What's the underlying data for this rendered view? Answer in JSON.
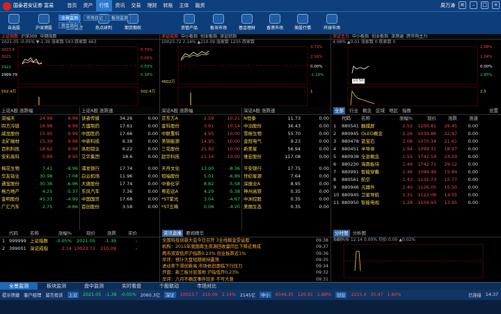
{
  "app": {
    "title": "国泰君安证券 富易",
    "user": "周万涛"
  },
  "menu": [
    "首页",
    "资产",
    "行情",
    "资讯",
    "交易",
    "理财",
    "转账",
    "主体",
    "融资"
  ],
  "tools": [
    "自选股",
    "沪深港股",
    "全景监控",
    "热点研判",
    "期货期权",
    "资管产品",
    "板块市场",
    "基金理财",
    "香港市场",
    "美股行情",
    "环球市场"
  ],
  "subtabs": [
    "全景监测",
    "市场日记",
    "板块监测",
    "资金流向"
  ],
  "panels": [
    {
      "tabs": [
        "上证指数",
        "沪深300",
        "中期指数"
      ],
      "info": "2021.05 -0.05% ▼-1.39 涨家数 593 跌家数 663",
      "yl": [
        "3023.6",
        "3021",
        "2922",
        "2999.79"
      ],
      "yr": [
        "0.70%",
        "0.05%",
        "0.03%",
        "0.30%"
      ],
      "vol": [
        "502.4万",
        "502.4万"
      ]
    },
    {
      "tabs": [
        "深证成指",
        "中小板指",
        "创业板指",
        "深证综指"
      ],
      "info": "10023.72 2.14% ▲210.09 涨家数 1235 跌家数",
      "yl": [
        "",
        "",
        "",
        ""
      ],
      "yr": [
        "3.73%",
        "2.16%",
        "0.00%",
        "-1.10%"
      ],
      "vol": [
        "4602万",
        "1"
      ]
    },
    {
      "tabs": [
        "深证主力",
        "中小板指",
        "创业板指",
        "深港通",
        "跨市场主力"
      ],
      "info": "4.08% ▲0.01 涨家数 0 跌家数 0",
      "yl": [
        "",
        "",
        "",
        ""
      ],
      "yr": [
        "2.68%",
        "1.04%",
        "0.00%",
        "2.85%"
      ],
      "vol": [
        "10.50",
        "2.5"
      ]
    }
  ],
  "sh_gainers": [
    [
      "润福天",
      "24.99",
      "9.99"
    ],
    [
      "四方冷链",
      "19.99",
      "9.99"
    ],
    [
      "威龙股份",
      "15.95",
      "9.99"
    ],
    [
      "北矿磁材",
      "15.39",
      "9.98"
    ],
    [
      "百利科技",
      "18.62",
      "9.98"
    ],
    [
      "安彩高科",
      "5.89",
      "9.95"
    ]
  ],
  "sh_losers": [
    [
      "梅花生物",
      "7.41",
      "-9.96"
    ],
    [
      "华友钴业",
      "30.98",
      "-7.08"
    ],
    [
      "通宝股份",
      "30.36",
      "-6.96"
    ],
    [
      "格力地产",
      "4.25",
      "-5.37"
    ],
    [
      "金明股份",
      "45.33",
      "-4.99"
    ],
    [
      "广汇汽车",
      "2.75",
      "-4.86"
    ]
  ],
  "sh_speed": [
    [
      "读者传媒",
      "34.26",
      "0.00"
    ],
    [
      "方盛制药",
      "17.61",
      "0.00"
    ],
    [
      "中国医药",
      "17.66",
      "0.00"
    ],
    [
      "中新科技",
      "6.38",
      "0.00"
    ],
    [
      "洛阳钼业",
      "6.22",
      "0.00"
    ],
    [
      "艾华集团",
      "18.6",
      "0.00"
    ]
  ],
  "sh_speed2": [
    [
      "浦发银行",
      "17.74",
      "0.00"
    ],
    [
      "白云机场",
      "11.96",
      "0.00"
    ],
    [
      "大唐股份",
      "17.74",
      "0.00"
    ],
    [
      "东风汽车",
      "7.36",
      "0.00"
    ],
    [
      "中国国贸",
      "17.68",
      "0.00"
    ],
    [
      "首创股份",
      "3.58",
      "0.00"
    ]
  ],
  "sz_gainers": [
    [
      "京东方A",
      "2.59",
      "10.21"
    ],
    [
      "金科股份",
      "3.91",
      "10.14"
    ],
    [
      "中联重科",
      "4.95",
      "10.00"
    ],
    [
      "美锦能源",
      "14.95",
      "10.00"
    ],
    [
      "三花股份",
      "25.92",
      "10.00"
    ],
    [
      "超华科技",
      "11.14",
      "10.00"
    ]
  ],
  "sz_losers": [
    [
      "天舟文化",
      "13.00",
      "-8.36"
    ],
    [
      "冠福股份",
      "5.01",
      "-6.89"
    ],
    [
      "中泰化学",
      "8.82",
      "-5.58"
    ],
    [
      "粤宏远A",
      "4.20",
      "-5.38"
    ],
    [
      "*ST紫光",
      "3.04",
      "-4.67"
    ],
    [
      "*ST五稀",
      "0.06",
      "-4.20"
    ]
  ],
  "sz_speed": [
    [
      "N恒泰",
      "11.73",
      "0.00"
    ],
    [
      "中泊股份",
      "36.43",
      "0.00"
    ],
    [
      "雪榕生物",
      "55.70",
      "0.00"
    ],
    [
      "金冠电气",
      "9.23",
      "0.00"
    ],
    [
      "新美星",
      "56.94",
      "0.00"
    ],
    [
      "维宏股份",
      "117.08",
      "0.00"
    ]
  ],
  "sz_speed2": [
    [
      "平安银行",
      "17.75",
      "0.00"
    ],
    [
      "世纪星源",
      "7.64",
      "0.00"
    ],
    [
      "深振业A",
      "8.95",
      "0.00"
    ],
    [
      "神州高铁",
      "0.35",
      "0.00"
    ],
    [
      "中洲控股",
      "0.35",
      "0.00"
    ],
    [
      "美丽生态",
      "0.35",
      "0.00"
    ]
  ],
  "headers": {
    "sh_a": "上证A股 涨跌幅",
    "sh_speed": "上证A股 涨跌速",
    "sz_a": "深证A股 涨跌幅",
    "sz_speed": "深证A股 涨跌速"
  },
  "rank": {
    "tabs": [
      "全部",
      "行业",
      "概念",
      "区域",
      "地区",
      "指数"
    ],
    "set": "设置",
    "headers": [
      "",
      "代码",
      "名称",
      "涨幅%",
      "现价",
      "涨跌",
      "涨速"
    ],
    "rows": [
      [
        "1",
        "880541",
        "触摸屏",
        "2.52",
        "1200.81",
        "29.45",
        "0.00"
      ],
      [
        "2",
        "880945",
        "OLED概念",
        "2.26",
        "1039.86",
        "22.97",
        "0.00"
      ],
      [
        "3",
        "880478",
        "蓝宝石",
        "2.08",
        "1070.34",
        "21.61",
        "0.00"
      ],
      [
        "4",
        "880451",
        "半导体",
        "1.94",
        "1099.31",
        "18.97",
        "0.00"
      ],
      [
        "5",
        "880938",
        "全息概念",
        "1.55",
        "1742.19",
        "24.29",
        "0.00"
      ],
      [
        "6",
        "880230",
        "海南板块",
        "1.49",
        "1742.71",
        "29.12",
        "0.00"
      ],
      [
        "7",
        "880991",
        "智能穿戴",
        "1.46",
        "1099.49",
        "15.89",
        "0.00"
      ],
      [
        "8",
        "880561",
        "航空",
        "1.43",
        "1135.73",
        "15.77",
        "0.00"
      ],
      [
        "9",
        "880946",
        "元器件",
        "1.40",
        "1126.05",
        "15.50",
        "0.00"
      ],
      [
        "10",
        "880945",
        "卫星导航",
        "1.31",
        "1122.08",
        "14.55",
        "0.00"
      ],
      [
        "11",
        "880950",
        "智能电视",
        "1.28",
        "1104.93",
        "13.95",
        "0.00"
      ]
    ]
  },
  "indices": {
    "headers": [
      "",
      "代码",
      "名称",
      "涨幅%",
      "现价",
      "涨跌",
      "买价"
    ],
    "rows": [
      [
        "1",
        "999999",
        "上证指数",
        "-0.05%",
        "2021.05",
        "-1.39",
        "-"
      ],
      [
        "2",
        "399001",
        "深证成指",
        "2.14",
        "10023.72",
        "210.09",
        "-"
      ]
    ]
  },
  "news": {
    "tabs": [
      "资讯直播",
      "要闻精华"
    ],
    "items": [
      [
        "全国科技创新大会今日召开 3主线掘金受益股",
        "09:38"
      ],
      [
        "机构：2015年我国再生资源回收量同比下降近两成",
        "09:37"
      ],
      [
        "两市双双低开沪指跌0.23% 创业板跌近1%",
        "09:36"
      ],
      [
        "早评：预计大盘短期维持震荡",
        "09:35"
      ],
      [
        "进动率下滑创新高 市场依旧面临下行压力",
        "09:34"
      ],
      [
        "开盘：新三板分层落地 沪指低开0.23%",
        "09:32"
      ],
      [
        "早评：六月不确定事件较多 不可大意",
        "09:31"
      ],
      [
        "国内主要财经媒体要闻摘编（5月30日）",
        "09:30"
      ],
      [
        "早评：多空推持暂时明朗 部分题材或有机会",
        "09:28"
      ],
      [
        "新能股份（002667）：关于公司股票临时停牌的公告",
        "09:28"
      ]
    ]
  },
  "analysis": {
    "tabs": [
      "分时图",
      "分析图"
    ],
    "info": "海翻科技 12.14 0.00% 均价:0.00 ▲0.02%"
  },
  "btabs": [
    "全景监测",
    "板块监测",
    "盘中监测",
    "实时看盘",
    "个股联动",
    "市场对比"
  ],
  "status": {
    "items": [
      "提示快捷",
      "客户经理",
      "留言投诉",
      "上证",
      "2021.05",
      "-1.39",
      "-0.05%",
      "2060.3亿",
      "深证",
      "10023.7",
      "210.09",
      "2.14%",
      "2145亿",
      "中小",
      "6549.35",
      "120.91",
      "1.88%",
      "创业",
      "2215.4",
      "35.47",
      "1.60%"
    ],
    "right": "已连接",
    "time": "14:37"
  }
}
